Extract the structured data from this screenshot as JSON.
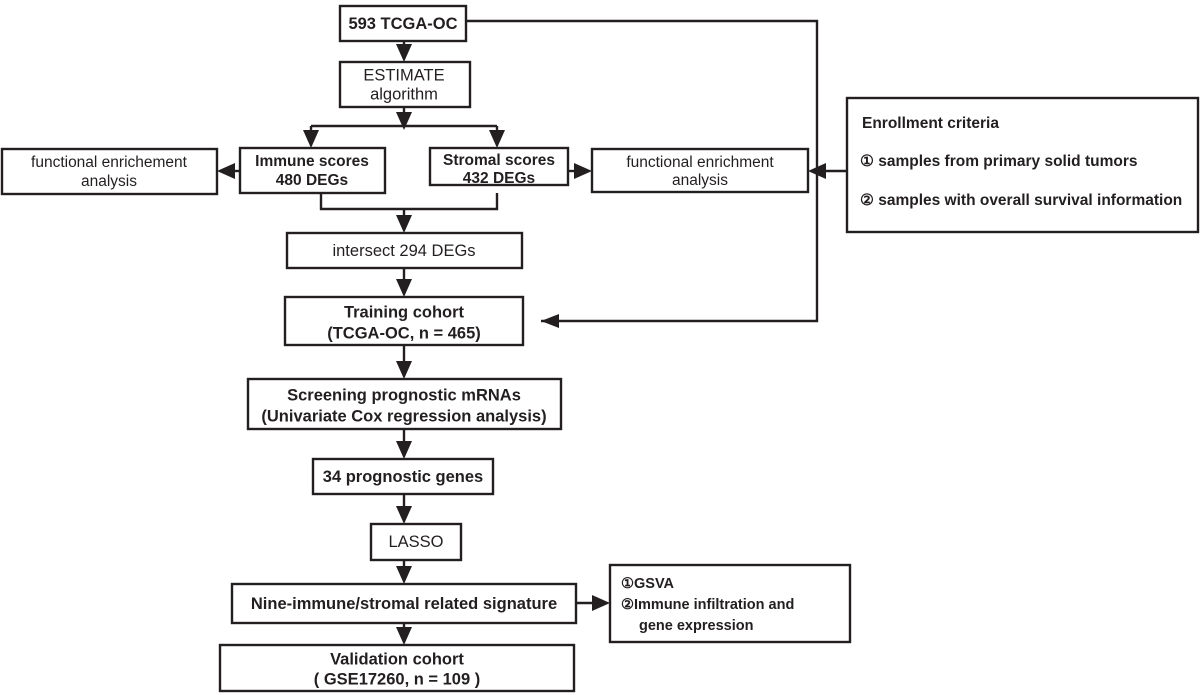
{
  "diagram": {
    "title": "Study workflow flowchart",
    "stroke_color": "#231f20",
    "box_fill": "#ffffff",
    "background": "#ffffff"
  },
  "nodes": {
    "source_cohort": {
      "line1": "593 TCGA-OC"
    },
    "estimate": {
      "line1": "ESTIMATE",
      "line2": "algorithm"
    },
    "immune_scores": {
      "line1": "Immune scores",
      "line2": "480 DEGs"
    },
    "stromal_scores": {
      "line1": "Stromal scores",
      "line2": "432 DEGs"
    },
    "enrichment_left": {
      "line1": "functional enrichement",
      "line2": "analysis"
    },
    "enrichment_right": {
      "line1": "functional enrichment",
      "line2": "analysis"
    },
    "intersect": {
      "line1": "intersect 294 DEGs"
    },
    "training_cohort": {
      "line1": "Training cohort",
      "line2": "(TCGA-OC, n = 465)"
    },
    "screening": {
      "line1": "Screening prognostic mRNAs",
      "line2": "(Univariate Cox regression analysis)"
    },
    "prognostic_genes": {
      "line1": "34 prognostic genes"
    },
    "lasso": {
      "line1": "LASSO"
    },
    "signature": {
      "line1": "Nine-immune/stromal related signature"
    },
    "validation_cohort": {
      "line1": "Validation cohort",
      "line2": "( GSE17260, n = 109 )"
    },
    "enrollment_criteria": {
      "heading": "Enrollment criteria",
      "item1": "①  samples from primary solid tumors",
      "item2": "②  samples with overall survival information"
    },
    "downstream_analysis": {
      "item1": "①GSVA",
      "item2": "②Immune infiltration and",
      "item2b": "gene expression"
    }
  }
}
